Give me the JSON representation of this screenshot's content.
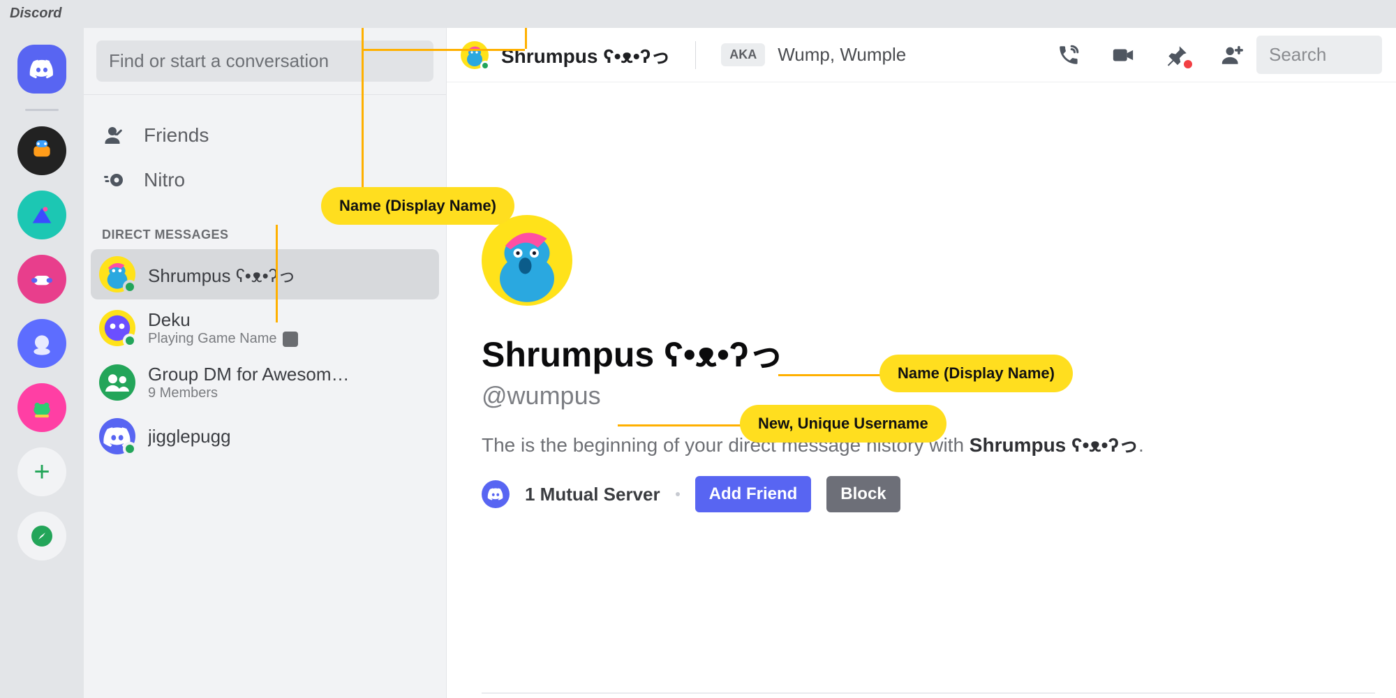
{
  "window": {
    "title": "Discord"
  },
  "sidebar": {
    "search_placeholder": "Find or start a conversation",
    "nav": {
      "friends": "Friends",
      "nitro": "Nitro"
    },
    "section_header": "DIRECT MESSAGES",
    "dms": [
      {
        "name": "Shrumpus ʕ•ᴥ•ʔっ",
        "active": true
      },
      {
        "name": "Deku",
        "sub": "Playing Game Name"
      },
      {
        "name": "Group DM for Awesom…",
        "sub": "9 Members"
      },
      {
        "name": "jigglepugg"
      }
    ]
  },
  "topbar": {
    "title": "Shrumpus ʕ•ᴥ•ʔっ",
    "aka_label": "AKA",
    "aka_names": "Wump, Wumple",
    "search_placeholder": "Search"
  },
  "content": {
    "display_name": "Shrumpus ʕ•ᴥ•ʔっ",
    "username": "@wumpus",
    "begin_prefix": "The is the beginning of your direct message history with ",
    "begin_name": "Shrumpus ʕ•ᴥ•ʔっ",
    "begin_suffix": ".",
    "mutual": "1 Mutual Server",
    "add_friend": "Add Friend",
    "block": "Block"
  },
  "annotations": {
    "display_name_top": "Name (Display Name)",
    "display_name_main": "Name (Display Name)",
    "username_main": "New, Unique  Username"
  }
}
